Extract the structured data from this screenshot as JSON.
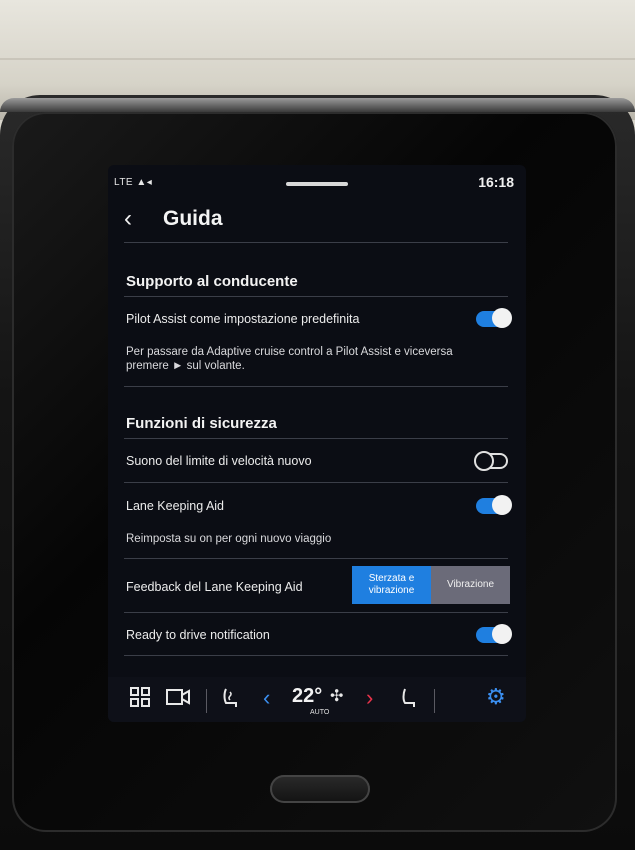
{
  "status": {
    "signal": "LTE",
    "time": "16:18"
  },
  "header": {
    "back_icon": "chevron-left-icon",
    "title": "Guida"
  },
  "sections": {
    "driver_support": {
      "title": "Supporto al conducente",
      "pilot_assist": {
        "label": "Pilot Assist come impostazione predefinita",
        "enabled": true,
        "description": "Per passare da Adaptive cruise control a Pilot Assist e viceversa premere ► sul volante."
      }
    },
    "safety": {
      "title": "Funzioni di sicurezza",
      "speed_limit_sound": {
        "label": "Suono del limite di velocità nuovo",
        "enabled": false
      },
      "lane_keeping": {
        "label": "Lane Keeping Aid",
        "enabled": true,
        "description": "Reimposta su on per ogni nuovo viaggio"
      },
      "lane_keeping_feedback": {
        "label": "Feedback del Lane Keeping Aid",
        "options": [
          "Sterzata e vibrazione",
          "Vibrazione"
        ],
        "selected": "Sterzata e vibrazione"
      },
      "ready_to_drive": {
        "label": "Ready to drive notification",
        "enabled": true
      }
    }
  },
  "bottom_bar": {
    "climate": {
      "temperature": "22°",
      "mode": "AUTO"
    },
    "icons": [
      "apps-grid-icon",
      "camera-icon",
      "seat-heat-icon",
      "chevron-left-icon",
      "fan-icon",
      "chevron-right-icon",
      "seat-icon",
      "settings-gear-icon"
    ]
  },
  "colors": {
    "accent": "#1f7fe0",
    "screen_bg": "#0b0d14",
    "segment_inactive": "#6b6b79"
  }
}
